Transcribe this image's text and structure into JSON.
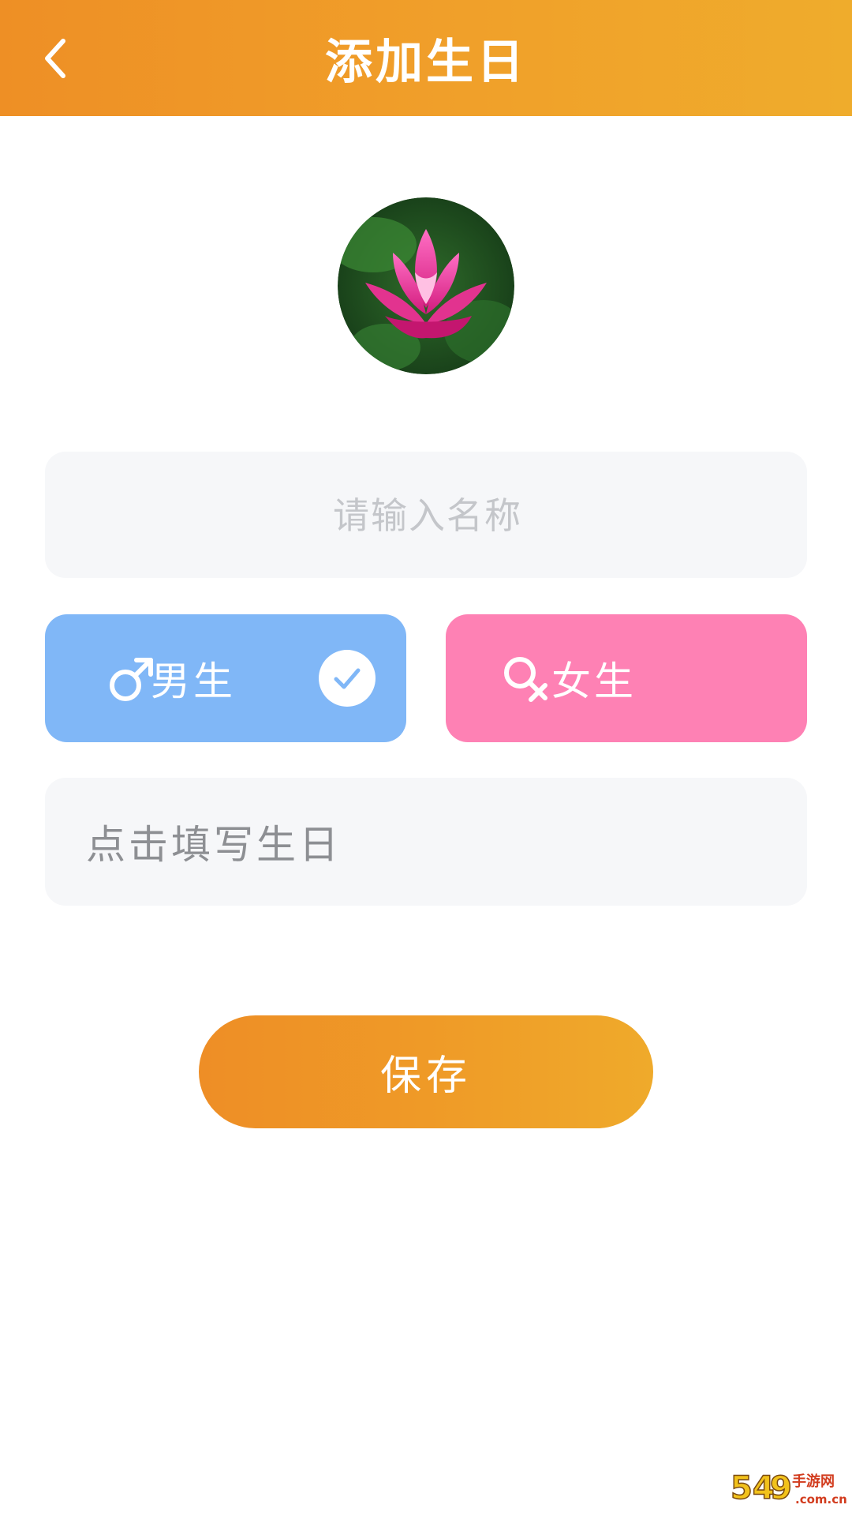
{
  "header": {
    "title": "添加生日",
    "back_icon": "chevron-left-icon"
  },
  "avatar": {
    "description_icon": "lotus-avatar"
  },
  "name_input": {
    "placeholder": "请输入名称",
    "value": ""
  },
  "gender": {
    "male_label": "男生",
    "female_label": "女生",
    "selected": "male"
  },
  "birthday": {
    "label": "点击填写生日"
  },
  "save_button": {
    "label": "保存"
  },
  "watermark": {
    "text": "54.9手游网 .com.cn"
  },
  "colors": {
    "header_gradient_start": "#ee8f25",
    "header_gradient_end": "#efac2c",
    "male_bg": "#80b7f7",
    "female_bg": "#fe81b4",
    "input_bg": "#f6f7f9",
    "placeholder": "#c4c6ca",
    "birthday_text": "#8d8f93"
  }
}
